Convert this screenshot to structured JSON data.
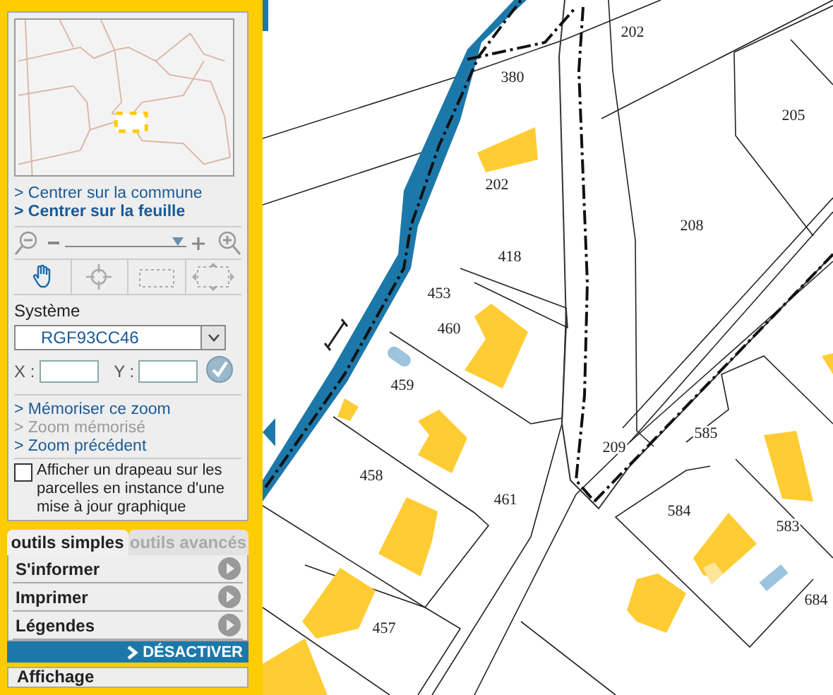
{
  "center_links": [
    {
      "label": "> Centrer sur la commune",
      "bold": false
    },
    {
      "label": "> Centrer sur la feuille",
      "bold": true
    }
  ],
  "zoom_slider": {
    "level": 0.93
  },
  "tools": [
    {
      "kind": "pan",
      "selected": true
    },
    {
      "kind": "center",
      "selected": false
    },
    {
      "kind": "select",
      "selected": false
    },
    {
      "kind": "extent",
      "selected": false
    }
  ],
  "system": {
    "label": "Système",
    "value": "RGF93CC46"
  },
  "coordinates": {
    "x_label": "X :",
    "y_label": "Y :"
  },
  "zoom_links": [
    {
      "label": "> Mémoriser ce zoom",
      "disabled": false
    },
    {
      "label": "> Zoom mémorisé",
      "disabled": true
    },
    {
      "label": "> Zoom précédent",
      "disabled": false
    }
  ],
  "flag_option": {
    "label": "Afficher un drapeau sur les parcelles en instance d'une mise à jour graphique",
    "checked": false
  },
  "tabs": [
    {
      "label": "outils simples",
      "selected": true
    },
    {
      "label": "outils avancés",
      "selected": false
    }
  ],
  "tool_menu": [
    "S'informer",
    "Imprimer",
    "Légendes"
  ],
  "deactivate": {
    "label": "DÉSACTIVER"
  },
  "next_panel": {
    "title": "Affichage"
  },
  "map": {
    "parcel_labels": [
      "202",
      "380",
      "205",
      "202",
      "208",
      "418",
      "453",
      "460",
      "459",
      "458",
      "461",
      "209",
      "585",
      "584",
      "583",
      "684",
      "457"
    ]
  }
}
